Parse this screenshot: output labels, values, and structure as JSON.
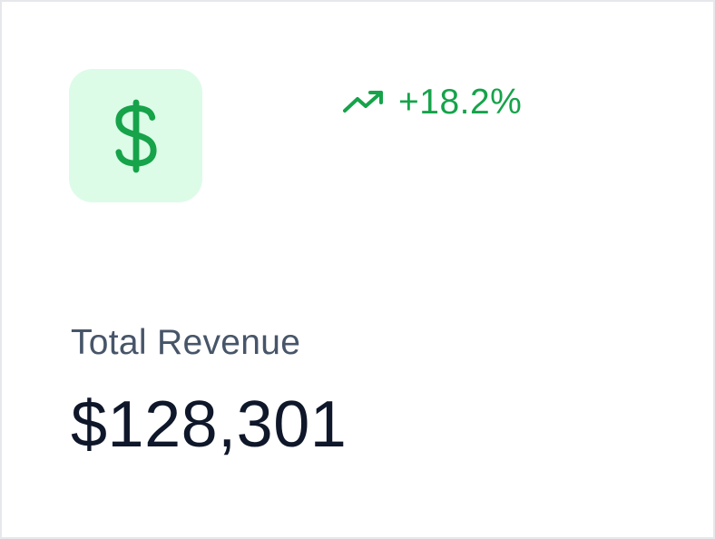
{
  "card": {
    "icon": "dollar-sign-icon",
    "label": "Total Revenue",
    "value": "$128,301",
    "trend": {
      "icon": "trending-up-icon",
      "value": "+18.2%"
    }
  },
  "colors": {
    "accent": "#16a34a",
    "accent_bg": "#dcfce7",
    "label": "#475569",
    "value": "#0f172a",
    "border": "#e5e7eb"
  }
}
